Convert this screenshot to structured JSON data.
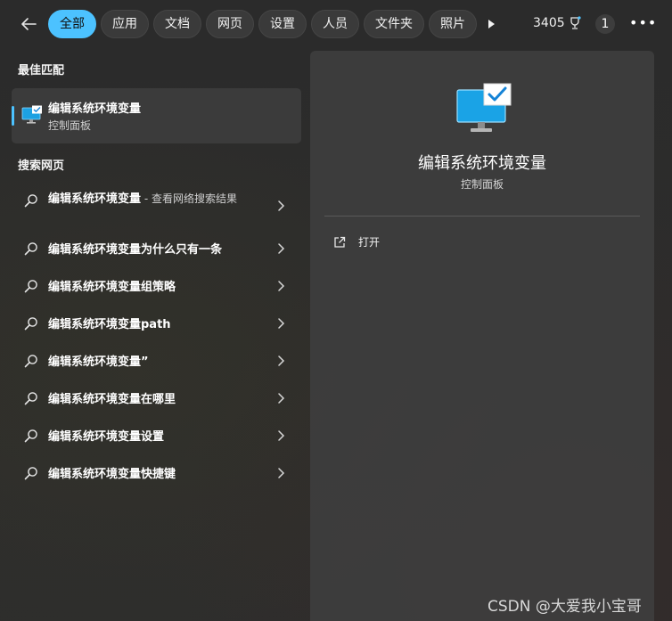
{
  "tabs": [
    "全部",
    "应用",
    "文档",
    "网页",
    "设置",
    "人员",
    "文件夹",
    "照片"
  ],
  "header": {
    "points": "3405",
    "badge": "1"
  },
  "best_match": {
    "section_title": "最佳匹配",
    "name": "编辑系统环境变量",
    "subtitle": "控制面板"
  },
  "web_search": {
    "section_title": "搜索网页",
    "items": [
      {
        "bold": "编辑系统环境变量",
        "suffix": " - 查看网络搜索结果"
      },
      {
        "bold": "编辑系统环境变量为什么只有一条",
        "suffix": ""
      },
      {
        "bold": "编辑系统环境变量组策略",
        "suffix": ""
      },
      {
        "bold": "编辑系统环境变量path",
        "suffix": ""
      },
      {
        "bold": "编辑系统环境变量”",
        "suffix": ""
      },
      {
        "bold": "编辑系统环境变量在哪里",
        "suffix": ""
      },
      {
        "bold": "编辑系统环境变量设置",
        "suffix": ""
      },
      {
        "bold": "编辑系统环境变量快捷键",
        "suffix": ""
      }
    ]
  },
  "detail": {
    "title": "编辑系统环境变量",
    "subtitle": "控制面板",
    "action_open": "打开"
  },
  "watermark": "CSDN @大爱我小宝哥",
  "colors": {
    "accent": "#4cc2ff",
    "background": "#2b2b2b",
    "pane": "#3e3e3e"
  }
}
